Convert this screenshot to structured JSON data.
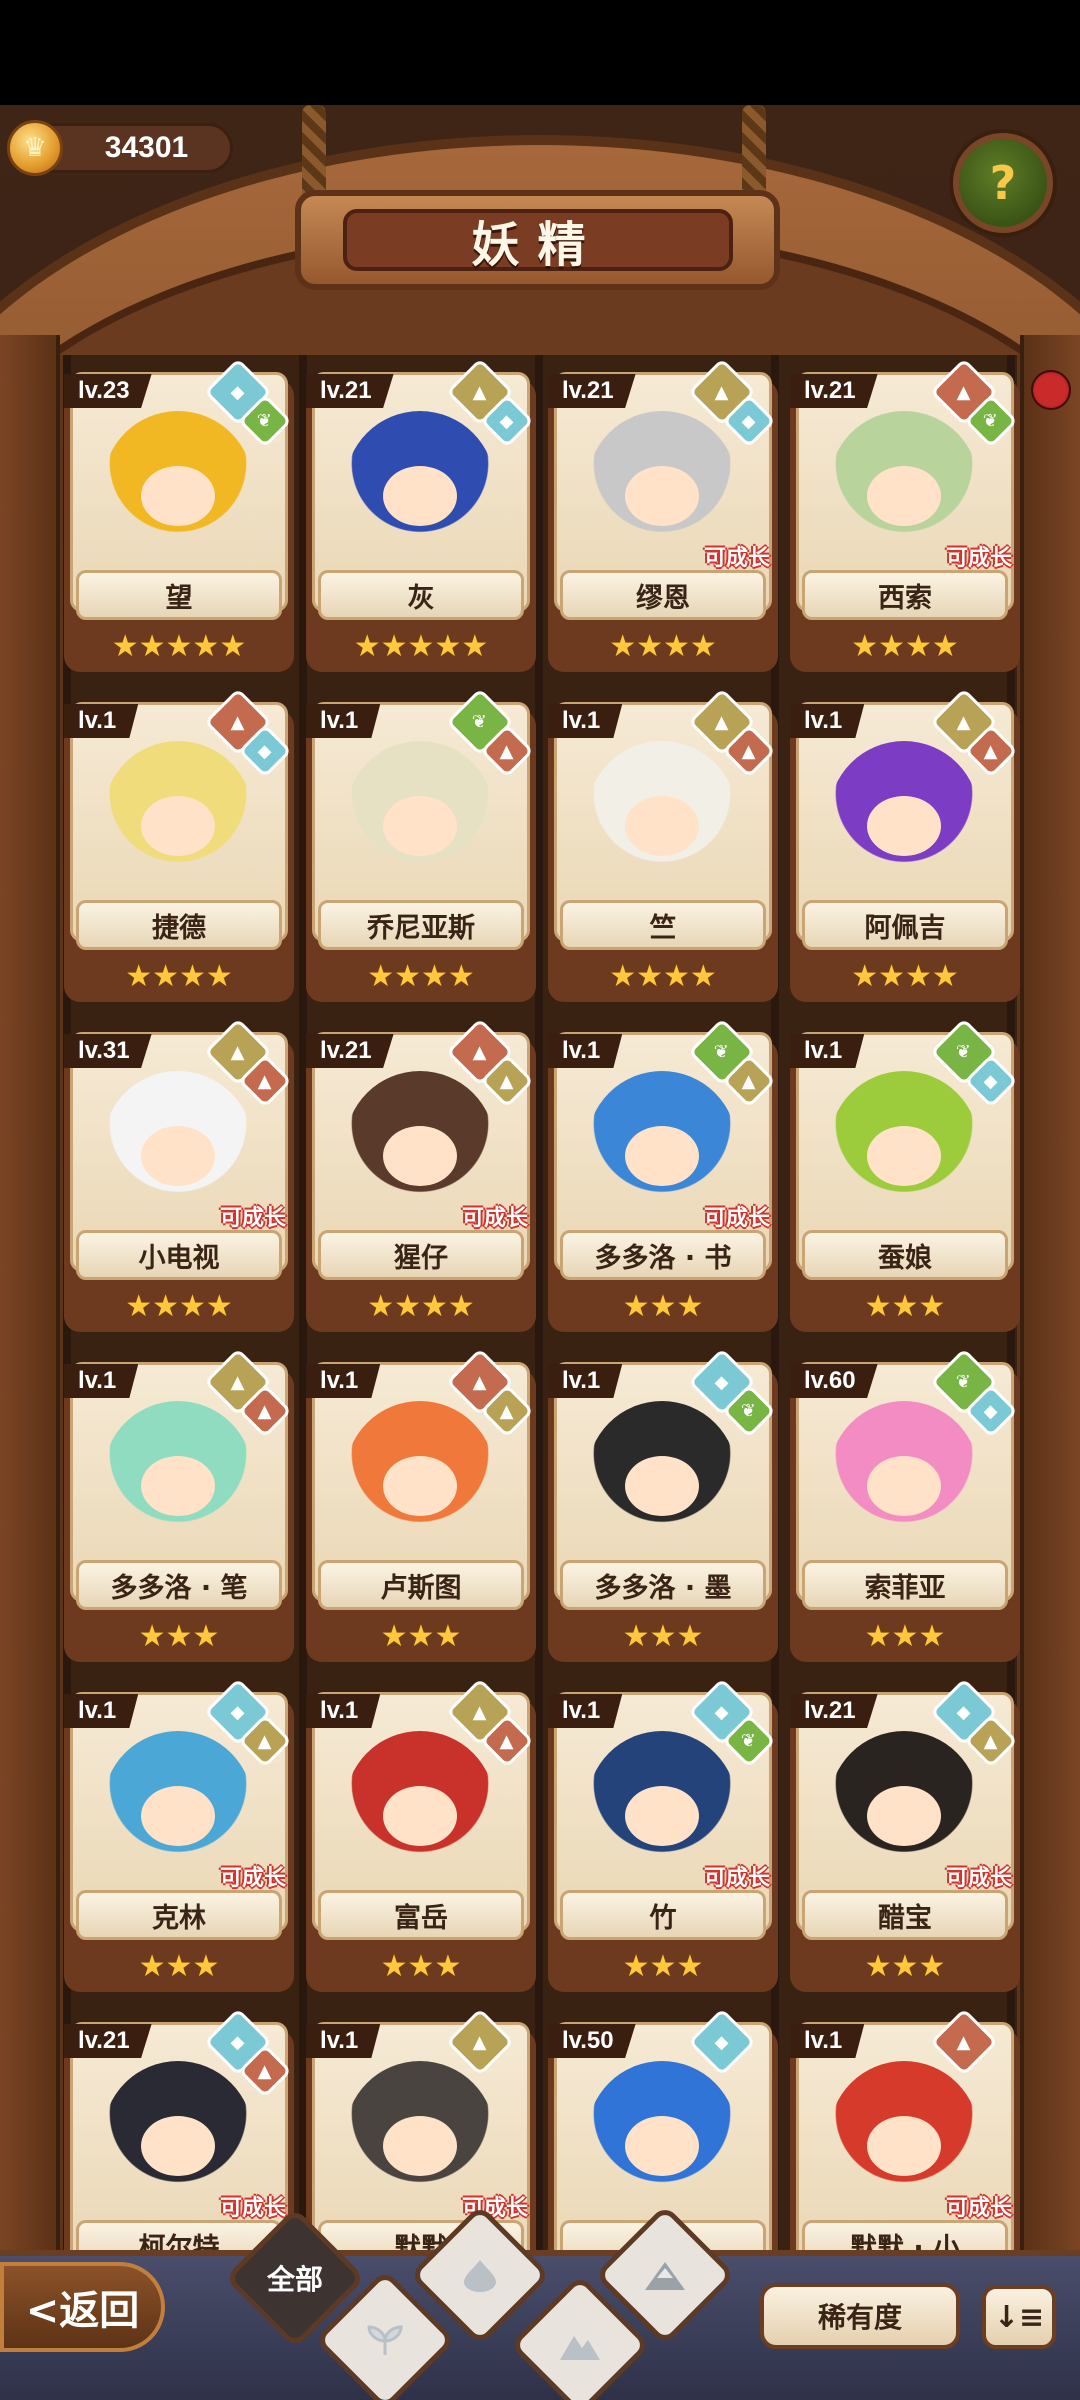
{
  "header": {
    "coins": "34301",
    "title": "妖精",
    "help_symbol": "?"
  },
  "colors": {
    "water": "#7cc9d6",
    "earth": "#b8a255",
    "fire": "#c46a4e",
    "wood": "#79b544",
    "grow_outline": "#d2342d",
    "star": "#ffc83d"
  },
  "grow_label": "可成长",
  "cards": [
    {
      "level": "lv.23",
      "name": "望",
      "stars": "★★★★★",
      "elements": [
        "water",
        "wood"
      ],
      "growable": false,
      "hair": "#f2b823"
    },
    {
      "level": "lv.21",
      "name": "灰",
      "stars": "★★★★★",
      "elements": [
        "earth",
        "water"
      ],
      "growable": false,
      "hair": "#2f4cb0"
    },
    {
      "level": "lv.21",
      "name": "缪恩",
      "stars": "★★★★",
      "elements": [
        "earth",
        "water"
      ],
      "growable": true,
      "hair": "#c8c8c8"
    },
    {
      "level": "lv.21",
      "name": "西索",
      "stars": "★★★★",
      "elements": [
        "fire",
        "wood"
      ],
      "growable": true,
      "hair": "#b8d39b"
    },
    {
      "level": "lv.1",
      "name": "捷德",
      "stars": "★★★★",
      "elements": [
        "fire",
        "water"
      ],
      "growable": false,
      "hair": "#f0dc7a"
    },
    {
      "level": "lv.1",
      "name": "乔尼亚斯",
      "stars": "★★★★",
      "elements": [
        "wood",
        "fire"
      ],
      "growable": false,
      "hair": "#e7e1c4"
    },
    {
      "level": "lv.1",
      "name": "竺",
      "stars": "★★★★",
      "elements": [
        "earth",
        "fire"
      ],
      "growable": false,
      "hair": "#f2f0e6"
    },
    {
      "level": "lv.1",
      "name": "阿佩吉",
      "stars": "★★★★",
      "elements": [
        "earth",
        "fire"
      ],
      "growable": false,
      "hair": "#7c3cc4"
    },
    {
      "level": "lv.31",
      "name": "小电视",
      "stars": "★★★★",
      "elements": [
        "earth",
        "fire"
      ],
      "growable": true,
      "hair": "#f4f4f4"
    },
    {
      "level": "lv.21",
      "name": "猩仔",
      "stars": "★★★★",
      "elements": [
        "fire",
        "earth"
      ],
      "growable": true,
      "hair": "#5a3a2a"
    },
    {
      "level": "lv.1",
      "name": "多多洛 · 书",
      "stars": "★★★",
      "elements": [
        "wood",
        "earth"
      ],
      "growable": true,
      "hair": "#3b86d6"
    },
    {
      "level": "lv.1",
      "name": "蚕娘",
      "stars": "★★★",
      "elements": [
        "wood",
        "water"
      ],
      "growable": false,
      "hair": "#9ccb3c"
    },
    {
      "level": "lv.1",
      "name": "多多洛 · 笔",
      "stars": "★★★",
      "elements": [
        "earth",
        "fire"
      ],
      "growable": false,
      "hair": "#8fdcc0"
    },
    {
      "level": "lv.1",
      "name": "卢斯图",
      "stars": "★★★",
      "elements": [
        "fire",
        "earth"
      ],
      "growable": false,
      "hair": "#f0783a"
    },
    {
      "level": "lv.1",
      "name": "多多洛 · 墨",
      "stars": "★★★",
      "elements": [
        "water",
        "wood"
      ],
      "growable": false,
      "hair": "#2a2a2a"
    },
    {
      "level": "lv.60",
      "name": "索菲亚",
      "stars": "★★★",
      "elements": [
        "wood",
        "water"
      ],
      "growable": false,
      "hair": "#f28cc3"
    },
    {
      "level": "lv.1",
      "name": "克林",
      "stars": "★★★",
      "elements": [
        "water",
        "earth"
      ],
      "growable": true,
      "hair": "#4aa7d6"
    },
    {
      "level": "lv.1",
      "name": "富岳",
      "stars": "★★★",
      "elements": [
        "earth",
        "fire"
      ],
      "growable": false,
      "hair": "#c8322a"
    },
    {
      "level": "lv.1",
      "name": "竹",
      "stars": "★★★",
      "elements": [
        "water",
        "wood"
      ],
      "growable": true,
      "hair": "#23437a"
    },
    {
      "level": "lv.21",
      "name": "醋宝",
      "stars": "★★★",
      "elements": [
        "water",
        "earth"
      ],
      "growable": true,
      "hair": "#2a2420"
    },
    {
      "level": "lv.21",
      "name": "柯尔特",
      "stars": "",
      "elements": [
        "water",
        "fire"
      ],
      "growable": true,
      "hair": "#2a2a34"
    },
    {
      "level": "lv.1",
      "name": "默默",
      "stars": "",
      "elements": [
        "earth"
      ],
      "growable": true,
      "hair": "#4a4440"
    },
    {
      "level": "lv.50",
      "name": "默",
      "stars": "",
      "elements": [
        "water"
      ],
      "growable": false,
      "hair": "#2f74d6"
    },
    {
      "level": "lv.1",
      "name": "默默 · 小",
      "stars": "",
      "elements": [
        "fire"
      ],
      "growable": true,
      "hair": "#d63a2a"
    }
  ],
  "footer": {
    "back_label": "<返回",
    "filter_all_label": "全部",
    "rarity_label": "稀有度",
    "sort_symbol": "↓≡"
  }
}
